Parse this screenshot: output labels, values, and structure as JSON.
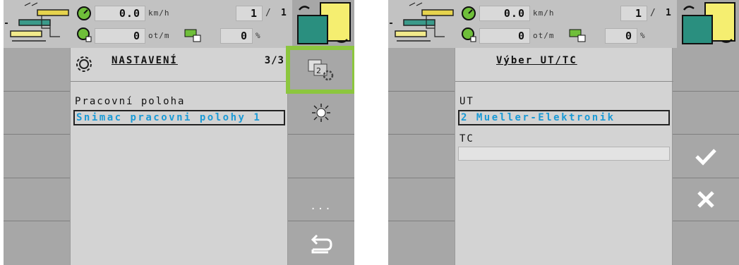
{
  "left": {
    "status": {
      "speed": "0.0",
      "speed_unit": "km/h",
      "rpm": "0",
      "rpm_unit": "ot/m",
      "gear_current": "1",
      "gear_sep": "/",
      "gear_total": "1",
      "percent": "0",
      "percent_unit": "%"
    },
    "page_title": "NASTAVENÍ",
    "page_number": "3/3",
    "item_label": "Pracovní poloha",
    "item_value": "Snimac pracovni polohy 1",
    "softkeys_right": [
      "ut-select-icon",
      "light-icon",
      "more-icon",
      "back-icon"
    ],
    "more_label": "..."
  },
  "right": {
    "status": {
      "speed": "0.0",
      "speed_unit": "km/h",
      "rpm": "0",
      "rpm_unit": "ot/m",
      "gear_current": "1",
      "gear_sep": "/",
      "gear_total": "1",
      "percent": "0",
      "percent_unit": "%"
    },
    "page_title": "Výber UT/TC",
    "ut_label": "UT",
    "ut_value": "2 Mueller-Elektronik",
    "tc_label": "TC",
    "tc_value": "",
    "softkeys_right": [
      "check-icon",
      "close-icon"
    ]
  },
  "colors": {
    "highlight": "#8cc63e",
    "value_blue": "#1a9ad6",
    "screen_bg": "#a7a7a7",
    "content_bg": "#d3d3d3"
  }
}
